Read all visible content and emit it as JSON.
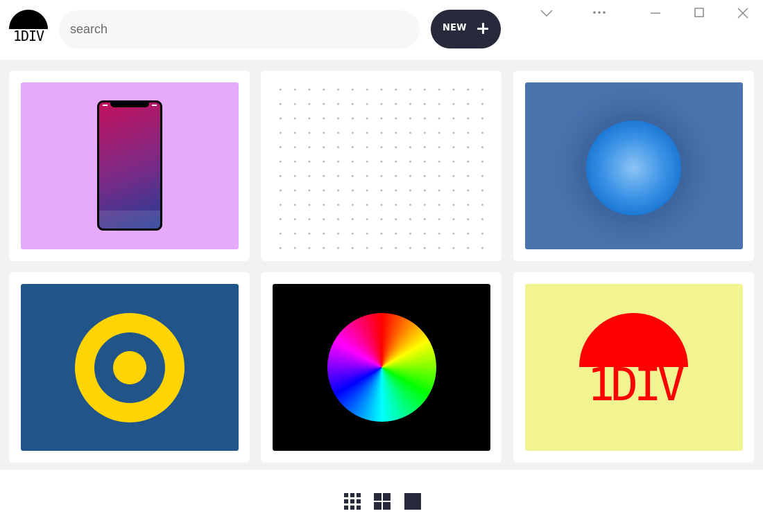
{
  "app": {
    "logo_text": "1DIV"
  },
  "header": {
    "search_placeholder": "search",
    "search_value": "",
    "new_button_label": "NEW",
    "window_controls": [
      "chevron-down-icon",
      "more-icon",
      "minimize-icon",
      "maximize-icon",
      "close-icon"
    ]
  },
  "gallery": {
    "cards": [
      {
        "icon": "phone",
        "background": "#e5aaf9"
      },
      {
        "icon": "dot-grid",
        "background": "#ffffff"
      },
      {
        "icon": "glowing-sphere",
        "background": "#4a74ae"
      },
      {
        "icon": "target",
        "background": "#215589",
        "accent": "#ffd402"
      },
      {
        "icon": "color-wheel",
        "background": "#000000"
      },
      {
        "icon": "1div-logo",
        "background": "#f1f490",
        "accent": "#ff0000",
        "text": "1DIV"
      }
    ]
  },
  "footer": {
    "view_modes": [
      "small-grid-icon",
      "medium-grid-icon",
      "single-view-icon"
    ]
  },
  "colors": {
    "accent_dark": "#262a3a",
    "page_background": "#f2f2f2"
  }
}
